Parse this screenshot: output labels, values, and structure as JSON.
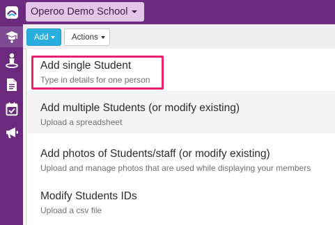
{
  "header": {
    "school_name": "Operoo Demo School"
  },
  "sidebar": {
    "items": [
      {
        "icon": "operoo-logo-icon"
      },
      {
        "icon": "graduation-cap-icon",
        "active": true
      },
      {
        "icon": "person-pin-icon"
      },
      {
        "icon": "document-icon"
      },
      {
        "icon": "calendar-check-icon"
      },
      {
        "icon": "megaphone-icon"
      }
    ]
  },
  "toolbar": {
    "add_label": "Add",
    "actions_label": "Actions"
  },
  "menu": {
    "items": [
      {
        "title": "Add single Student",
        "subtitle": "Type in details for one person"
      },
      {
        "title": "Add multiple Students (or modify existing)",
        "subtitle": "Upload a spreadsheet"
      },
      {
        "title": "Add photos of Students/staff (or modify existing)",
        "subtitle": "Upload and manage photos that are used while displaying your members"
      },
      {
        "title": "Modify Students IDs",
        "subtitle": "Upload a csv file"
      }
    ]
  },
  "colors": {
    "brand_purple": "#6b2a7e",
    "add_button_blue": "#2aaee0",
    "highlight_pink": "#f01f6e"
  }
}
